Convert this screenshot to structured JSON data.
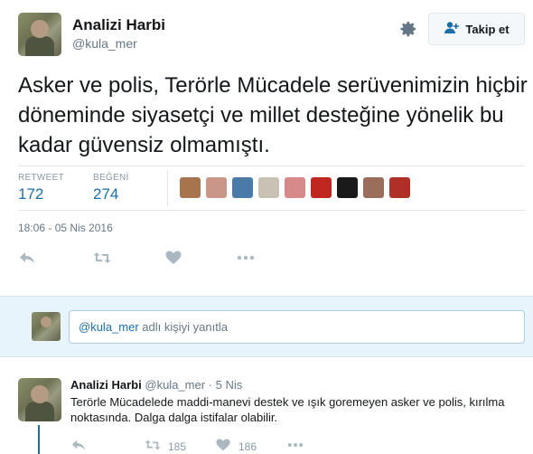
{
  "tweet": {
    "author_name": "Analizi Harbi",
    "author_handle": "@kula_mer",
    "follow_label": "Takip et",
    "text": "Asker ve polis, Terörle Mücadele serüvenimizin hiçbir döneminde siyasetçi ve millet desteğine yönelik bu kadar güvensiz olmamıştı.",
    "retweet_label": "RETWEET",
    "retweet_count": "172",
    "like_label": "BEĞENİ",
    "like_count": "274",
    "timestamp": "18:06 - 05 Nis 2016",
    "liker_colors": [
      "#a8744e",
      "#c99688",
      "#4a7aa8",
      "#c8c2b4",
      "#d88a8a",
      "#c0271f",
      "#1a1a1a",
      "#9a6e5a",
      "#b03028"
    ]
  },
  "reply": {
    "mention": "@kula_mer",
    "placeholder_rest": " adlı kişiyi yanıtla"
  },
  "reply_tweet": {
    "author_name": "Analizi Harbi",
    "author_handle": "@kula_mer",
    "dot": "·",
    "date": "5 Nis",
    "text": "Terörle Mücadelede maddi-manevi destek ve ışık goremeyen asker ve polis, kırılma noktasında. Dalga dalga istifalar olabilir.",
    "retweet_count": "185",
    "like_count": "186"
  },
  "icons": {
    "settings": "gear-icon",
    "follow": "add-user-icon",
    "reply": "reply-icon",
    "retweet": "retweet-icon",
    "like": "heart-icon",
    "more": "more-icon"
  },
  "colors": {
    "link": "#1b6ea8",
    "muted": "#657786",
    "reply_bg": "#e8f4fb"
  }
}
